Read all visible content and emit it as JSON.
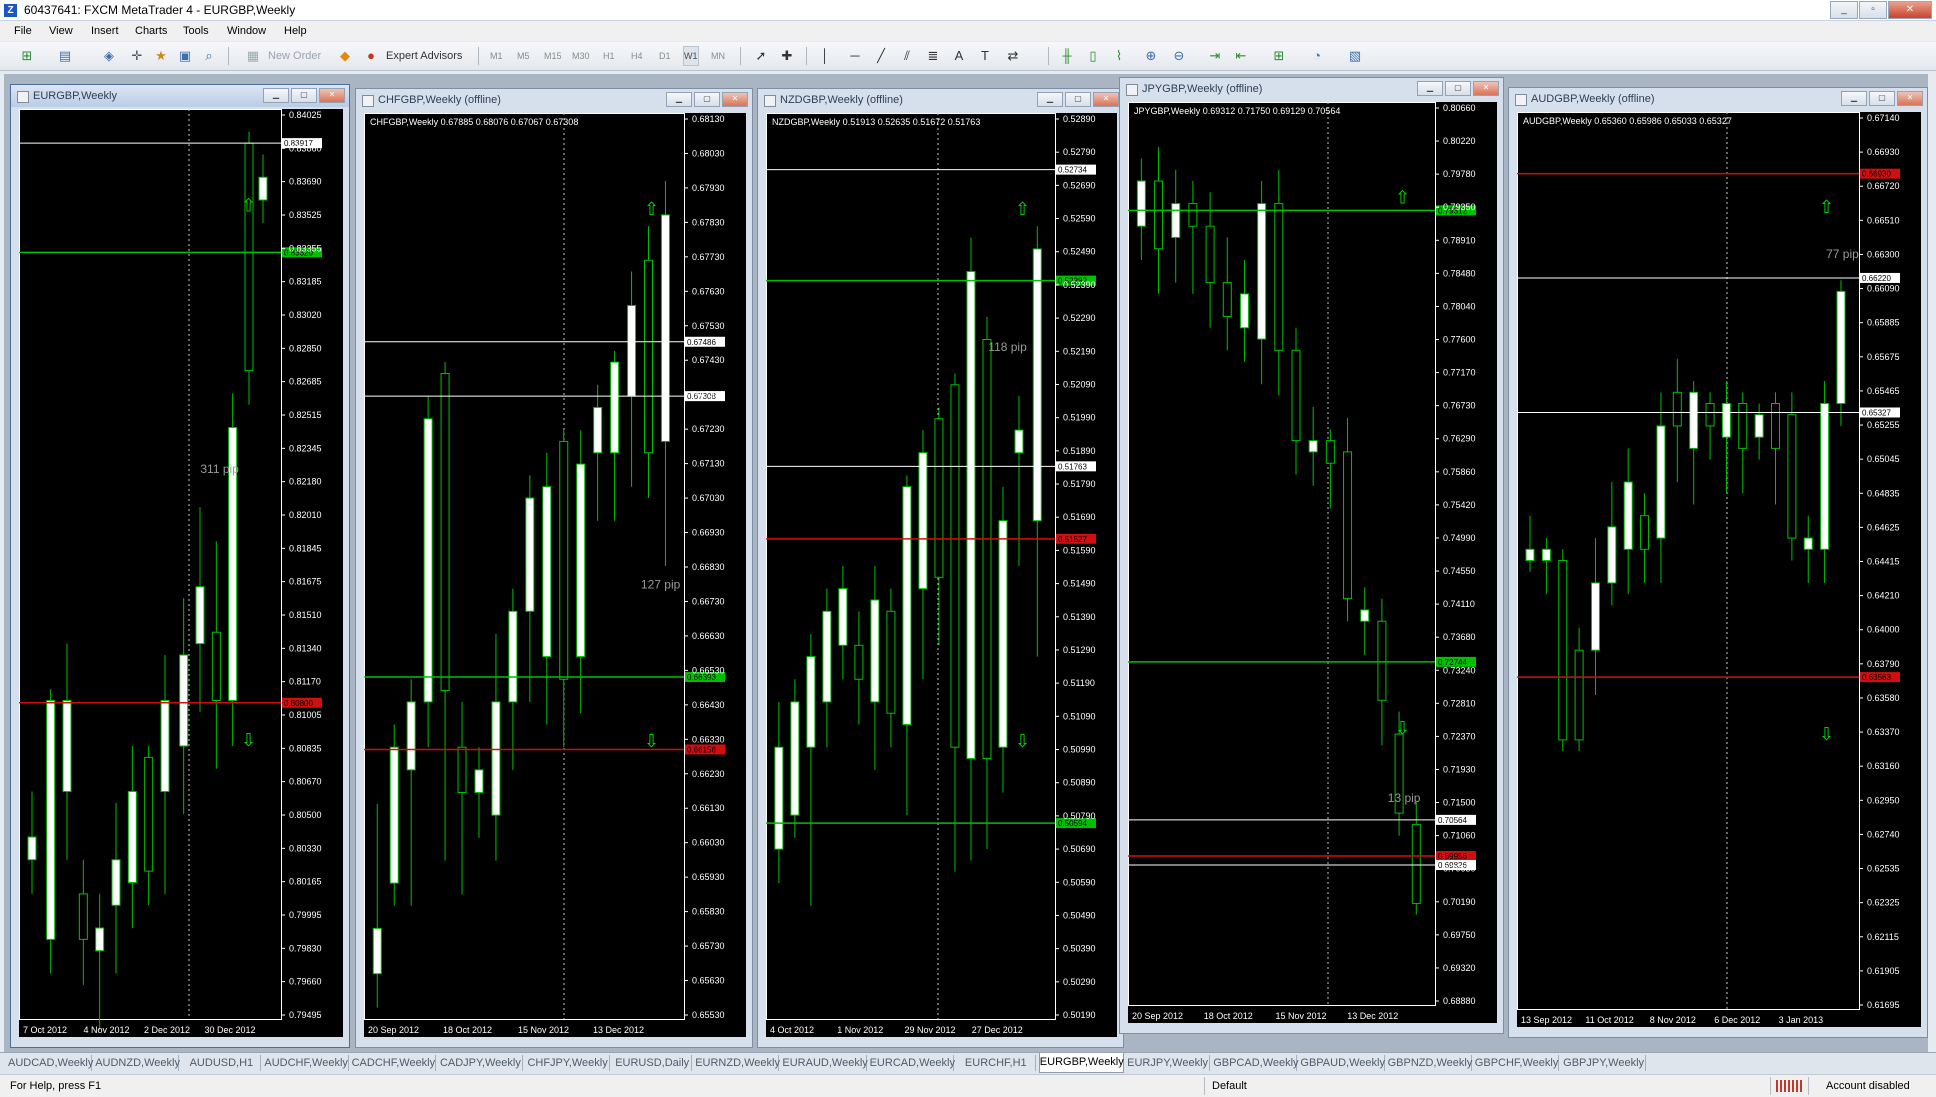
{
  "app": {
    "title": "60437641: FXCM MetaTrader 4 - EURGBP,Weekly",
    "window_controls": [
      "_",
      "▫",
      "✕"
    ]
  },
  "menu": [
    "File",
    "View",
    "Insert",
    "Charts",
    "Tools",
    "Window",
    "Help"
  ],
  "toolbar": {
    "new_order": "New Order",
    "expert_advisors": "Expert Advisors",
    "timeframes": [
      "M1",
      "M5",
      "M15",
      "M30",
      "H1",
      "H4",
      "D1",
      "W1",
      "MN"
    ],
    "active_timeframe": "W1"
  },
  "charts": [
    {
      "title": "EURGBP,Weekly",
      "active": true,
      "info": "",
      "price_labels": [
        "0.84025",
        "0.83860",
        "0.83690",
        "0.83525",
        "0.83355",
        "0.83185",
        "0.83020",
        "0.82850",
        "0.82685",
        "0.82515",
        "0.82345",
        "0.82180",
        "0.82010",
        "0.81845",
        "0.81675",
        "0.81510",
        "0.81340",
        "0.81170",
        "0.81005",
        "0.80835",
        "0.80670",
        "0.80500",
        "0.80330",
        "0.80165",
        "0.79995",
        "0.79830",
        "0.79660",
        "0.79495"
      ],
      "date_labels": [
        "7 Oct 2012",
        "4 Nov 2012",
        "2 Dec 2012",
        "30 Dec 2012"
      ],
      "pip_text": "311 pip",
      "markers": [
        {
          "value": "0.83917",
          "color": "#ffffff"
        },
        {
          "value": "0.83320",
          "color": "#00c000"
        },
        {
          "value": "0.80800",
          "color": "#d01010"
        }
      ]
    },
    {
      "title": "CHFGBP,Weekly (offline)",
      "active": false,
      "info": "CHFGBP,Weekly  0.67885 0.68076 0.67067 0.67308",
      "price_labels": [
        "0.68130",
        "0.68030",
        "0.67930",
        "0.67830",
        "0.67730",
        "0.67630",
        "0.67530",
        "0.67430",
        "0.67330",
        "0.67230",
        "0.67130",
        "0.67030",
        "0.66930",
        "0.66830",
        "0.66730",
        "0.66630",
        "0.66530",
        "0.66430",
        "0.66330",
        "0.66230",
        "0.66130",
        "0.66030",
        "0.65930",
        "0.65830",
        "0.65730",
        "0.65630",
        "0.65530"
      ],
      "date_labels": [
        "20 Sep 2012",
        "18 Oct 2012",
        "15 Nov 2012",
        "13 Dec 2012"
      ],
      "pip_text": "127 pip",
      "markers": [
        {
          "value": "0.67486",
          "color": "#ffffff"
        },
        {
          "value": "0.67308",
          "color": "#ffffff"
        },
        {
          "value": "0.66393",
          "color": "#00c000"
        },
        {
          "value": "0.66156",
          "color": "#d01010"
        }
      ]
    },
    {
      "title": "NZDGBP,Weekly (offline)",
      "active": false,
      "info": "NZDGBP,Weekly  0.51913 0.52635 0.51672 0.51763",
      "price_labels": [
        "0.52890",
        "0.52790",
        "0.52690",
        "0.52590",
        "0.52490",
        "0.52390",
        "0.52290",
        "0.52190",
        "0.52090",
        "0.51990",
        "0.51890",
        "0.51790",
        "0.51690",
        "0.51590",
        "0.51490",
        "0.51390",
        "0.51290",
        "0.51190",
        "0.51090",
        "0.50990",
        "0.50890",
        "0.50790",
        "0.50690",
        "0.50590",
        "0.50490",
        "0.50390",
        "0.50290",
        "0.50190"
      ],
      "date_labels": [
        "4 Oct 2012",
        "1 Nov 2012",
        "29 Nov 2012",
        "27 Dec 2012"
      ],
      "pip_text": "118 pip",
      "markers": [
        {
          "value": "0.52734",
          "color": "#ffffff"
        },
        {
          "value": "0.52382",
          "color": "#00c000"
        },
        {
          "value": "0.51763",
          "color": "#ffffff"
        },
        {
          "value": "0.51527",
          "color": "#d01010"
        },
        {
          "value": "0.50594",
          "color": "#00c000"
        }
      ]
    },
    {
      "title": "JPYGBP,Weekly (offline)",
      "active": false,
      "info": "JPYGBP,Weekly  0.69312 0.71750 0.69129 0.70564",
      "price_labels": [
        "0.80660",
        "0.80220",
        "0.79780",
        "0.79350",
        "0.78910",
        "0.78480",
        "0.78040",
        "0.77600",
        "0.77170",
        "0.76730",
        "0.76290",
        "0.75860",
        "0.75420",
        "0.74990",
        "0.74550",
        "0.74110",
        "0.73680",
        "0.73240",
        "0.72810",
        "0.72370",
        "0.71930",
        "0.71500",
        "0.71060",
        "0.70630",
        "0.70190",
        "0.69750",
        "0.69320",
        "0.68880"
      ],
      "date_labels": [
        "20 Sep 2012",
        "18 Oct 2012",
        "15 Nov 2012",
        "13 Dec 2012"
      ],
      "pip_text": "13 pip",
      "markers": [
        {
          "value": "0.79312",
          "color": "#00c000"
        },
        {
          "value": "0.72744",
          "color": "#00c000"
        },
        {
          "value": "0.70564",
          "color": "#ffffff"
        },
        {
          "value": "0.69956",
          "color": "#d01010"
        },
        {
          "value": "0.69826",
          "color": "#ffffff"
        }
      ]
    },
    {
      "title": "AUDGBP,Weekly (offline)",
      "active": false,
      "info": "AUDGBP,Weekly  0.65360 0.65986 0.65033 0.65327",
      "price_labels": [
        "0.67140",
        "0.66930",
        "0.66720",
        "0.66510",
        "0.66300",
        "0.66090",
        "0.65885",
        "0.65675",
        "0.65465",
        "0.65255",
        "0.65045",
        "0.64835",
        "0.64625",
        "0.64415",
        "0.64210",
        "0.64000",
        "0.63790",
        "0.63580",
        "0.63370",
        "0.63160",
        "0.62950",
        "0.62740",
        "0.62535",
        "0.62325",
        "0.62115",
        "0.61905",
        "0.61695"
      ],
      "date_labels": [
        "13 Sep 2012",
        "11 Oct 2012",
        "8 Nov 2012",
        "6 Dec 2012",
        "3 Jan 2013"
      ],
      "pip_text": "77 pip",
      "markers": [
        {
          "value": "0.66930",
          "color": "#d01010"
        },
        {
          "value": "0.66220",
          "color": "#ffffff"
        },
        {
          "value": "0.65327",
          "color": "#ffffff"
        },
        {
          "value": "0.63563",
          "color": "#d01010"
        }
      ]
    }
  ],
  "symbol_tabs": [
    "AUDCAD,Weekly",
    "AUDNZD,Weekly",
    "AUDUSD,H1",
    "AUDCHF,Weekly",
    "CADCHF,Weekly",
    "CADJPY,Weekly",
    "CHFJPY,Weekly",
    "EURUSD,Daily",
    "EURNZD,Weekly",
    "EURAUD,Weekly",
    "EURCAD,Weekly",
    "EURCHF,H1",
    "EURGBP,Weekly",
    "EURJPY,Weekly",
    "GBPCAD,Weekly",
    "GBPAUD,Weekly",
    "GBPNZD,Weekly",
    "GBPCHF,Weekly",
    "GBPJPY,Weekly"
  ],
  "active_tab": "EURGBP,Weekly",
  "status": {
    "help": "For Help, press F1",
    "profile": "Default",
    "account": "Account disabled"
  },
  "colors": {
    "bull_candle": "#ffffff",
    "bear_candle": "#000000",
    "candle_outline": "#00c000",
    "grid_white": "#ffffff",
    "level_green": "#00c000",
    "level_red": "#d01010",
    "arrow_green": "#00e000"
  }
}
